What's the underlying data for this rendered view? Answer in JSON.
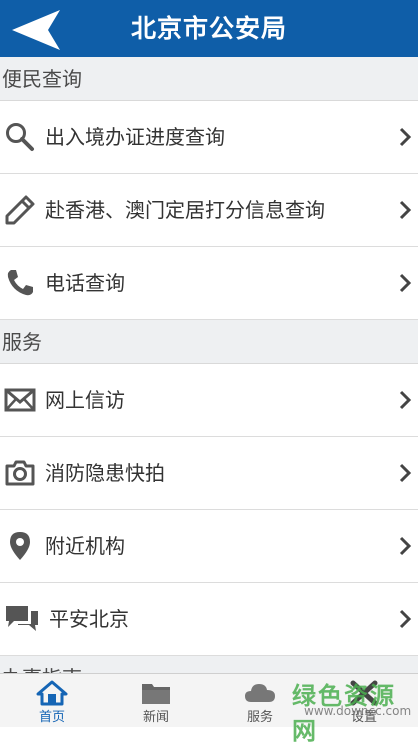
{
  "header": {
    "title": "北京市公安局",
    "back_icon": "back-arrow-icon"
  },
  "sections": [
    {
      "title": "便民查询",
      "items": [
        {
          "label": "出入境办证进度查询",
          "icon": "search-icon"
        },
        {
          "label": "赴香港、澳门定居打分信息查询",
          "icon": "pencil-icon"
        },
        {
          "label": "电话查询",
          "icon": "phone-icon"
        }
      ]
    },
    {
      "title": "服务",
      "items": [
        {
          "label": "网上信访",
          "icon": "mail-icon"
        },
        {
          "label": "消防隐患快拍",
          "icon": "camera-icon"
        },
        {
          "label": "附近机构",
          "icon": "location-pin-icon"
        },
        {
          "label": "平安北京",
          "icon": "chat-icon"
        }
      ]
    },
    {
      "title": "办事指南",
      "items": []
    }
  ],
  "tabbar": [
    {
      "label": "首页",
      "icon": "home-icon",
      "active": true
    },
    {
      "label": "新闻",
      "icon": "folder-icon",
      "active": false
    },
    {
      "label": "服务",
      "icon": "cloud-icon",
      "active": false
    },
    {
      "label": "设置",
      "icon": "tools-icon",
      "active": false
    }
  ],
  "watermark": {
    "logo_text": "绿色资源网",
    "url": "www.downcc.com"
  },
  "colors": {
    "header": "#0f5ea8",
    "active_tab": "#1565b5",
    "section_bg": "#eef0f2"
  }
}
